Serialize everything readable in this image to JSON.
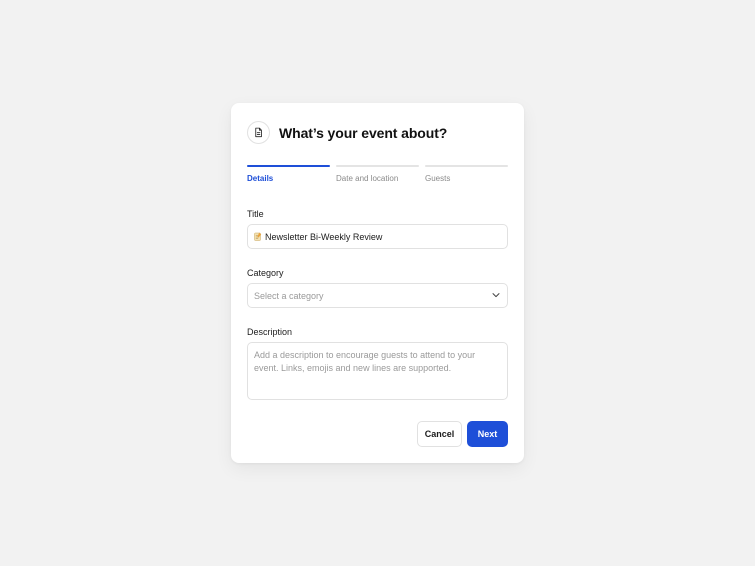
{
  "dialog": {
    "title": "What’s your event about?",
    "icon": "document-icon"
  },
  "steps": [
    {
      "label": "Details",
      "active": true
    },
    {
      "label": "Date and location",
      "active": false
    },
    {
      "label": "Guests",
      "active": false
    }
  ],
  "form": {
    "title_label": "Title",
    "title_value": "Newsletter Bi-Weekly Review",
    "category_label": "Category",
    "category_placeholder": "Select a category",
    "description_label": "Description",
    "description_placeholder": "Add a description to encourage guests to attend to your event. Links, emojis and new lines are supported."
  },
  "buttons": {
    "cancel_label": "Cancel",
    "next_label": "Next"
  },
  "colors": {
    "accent": "#1e4fd8",
    "background": "#f2f2f2"
  }
}
